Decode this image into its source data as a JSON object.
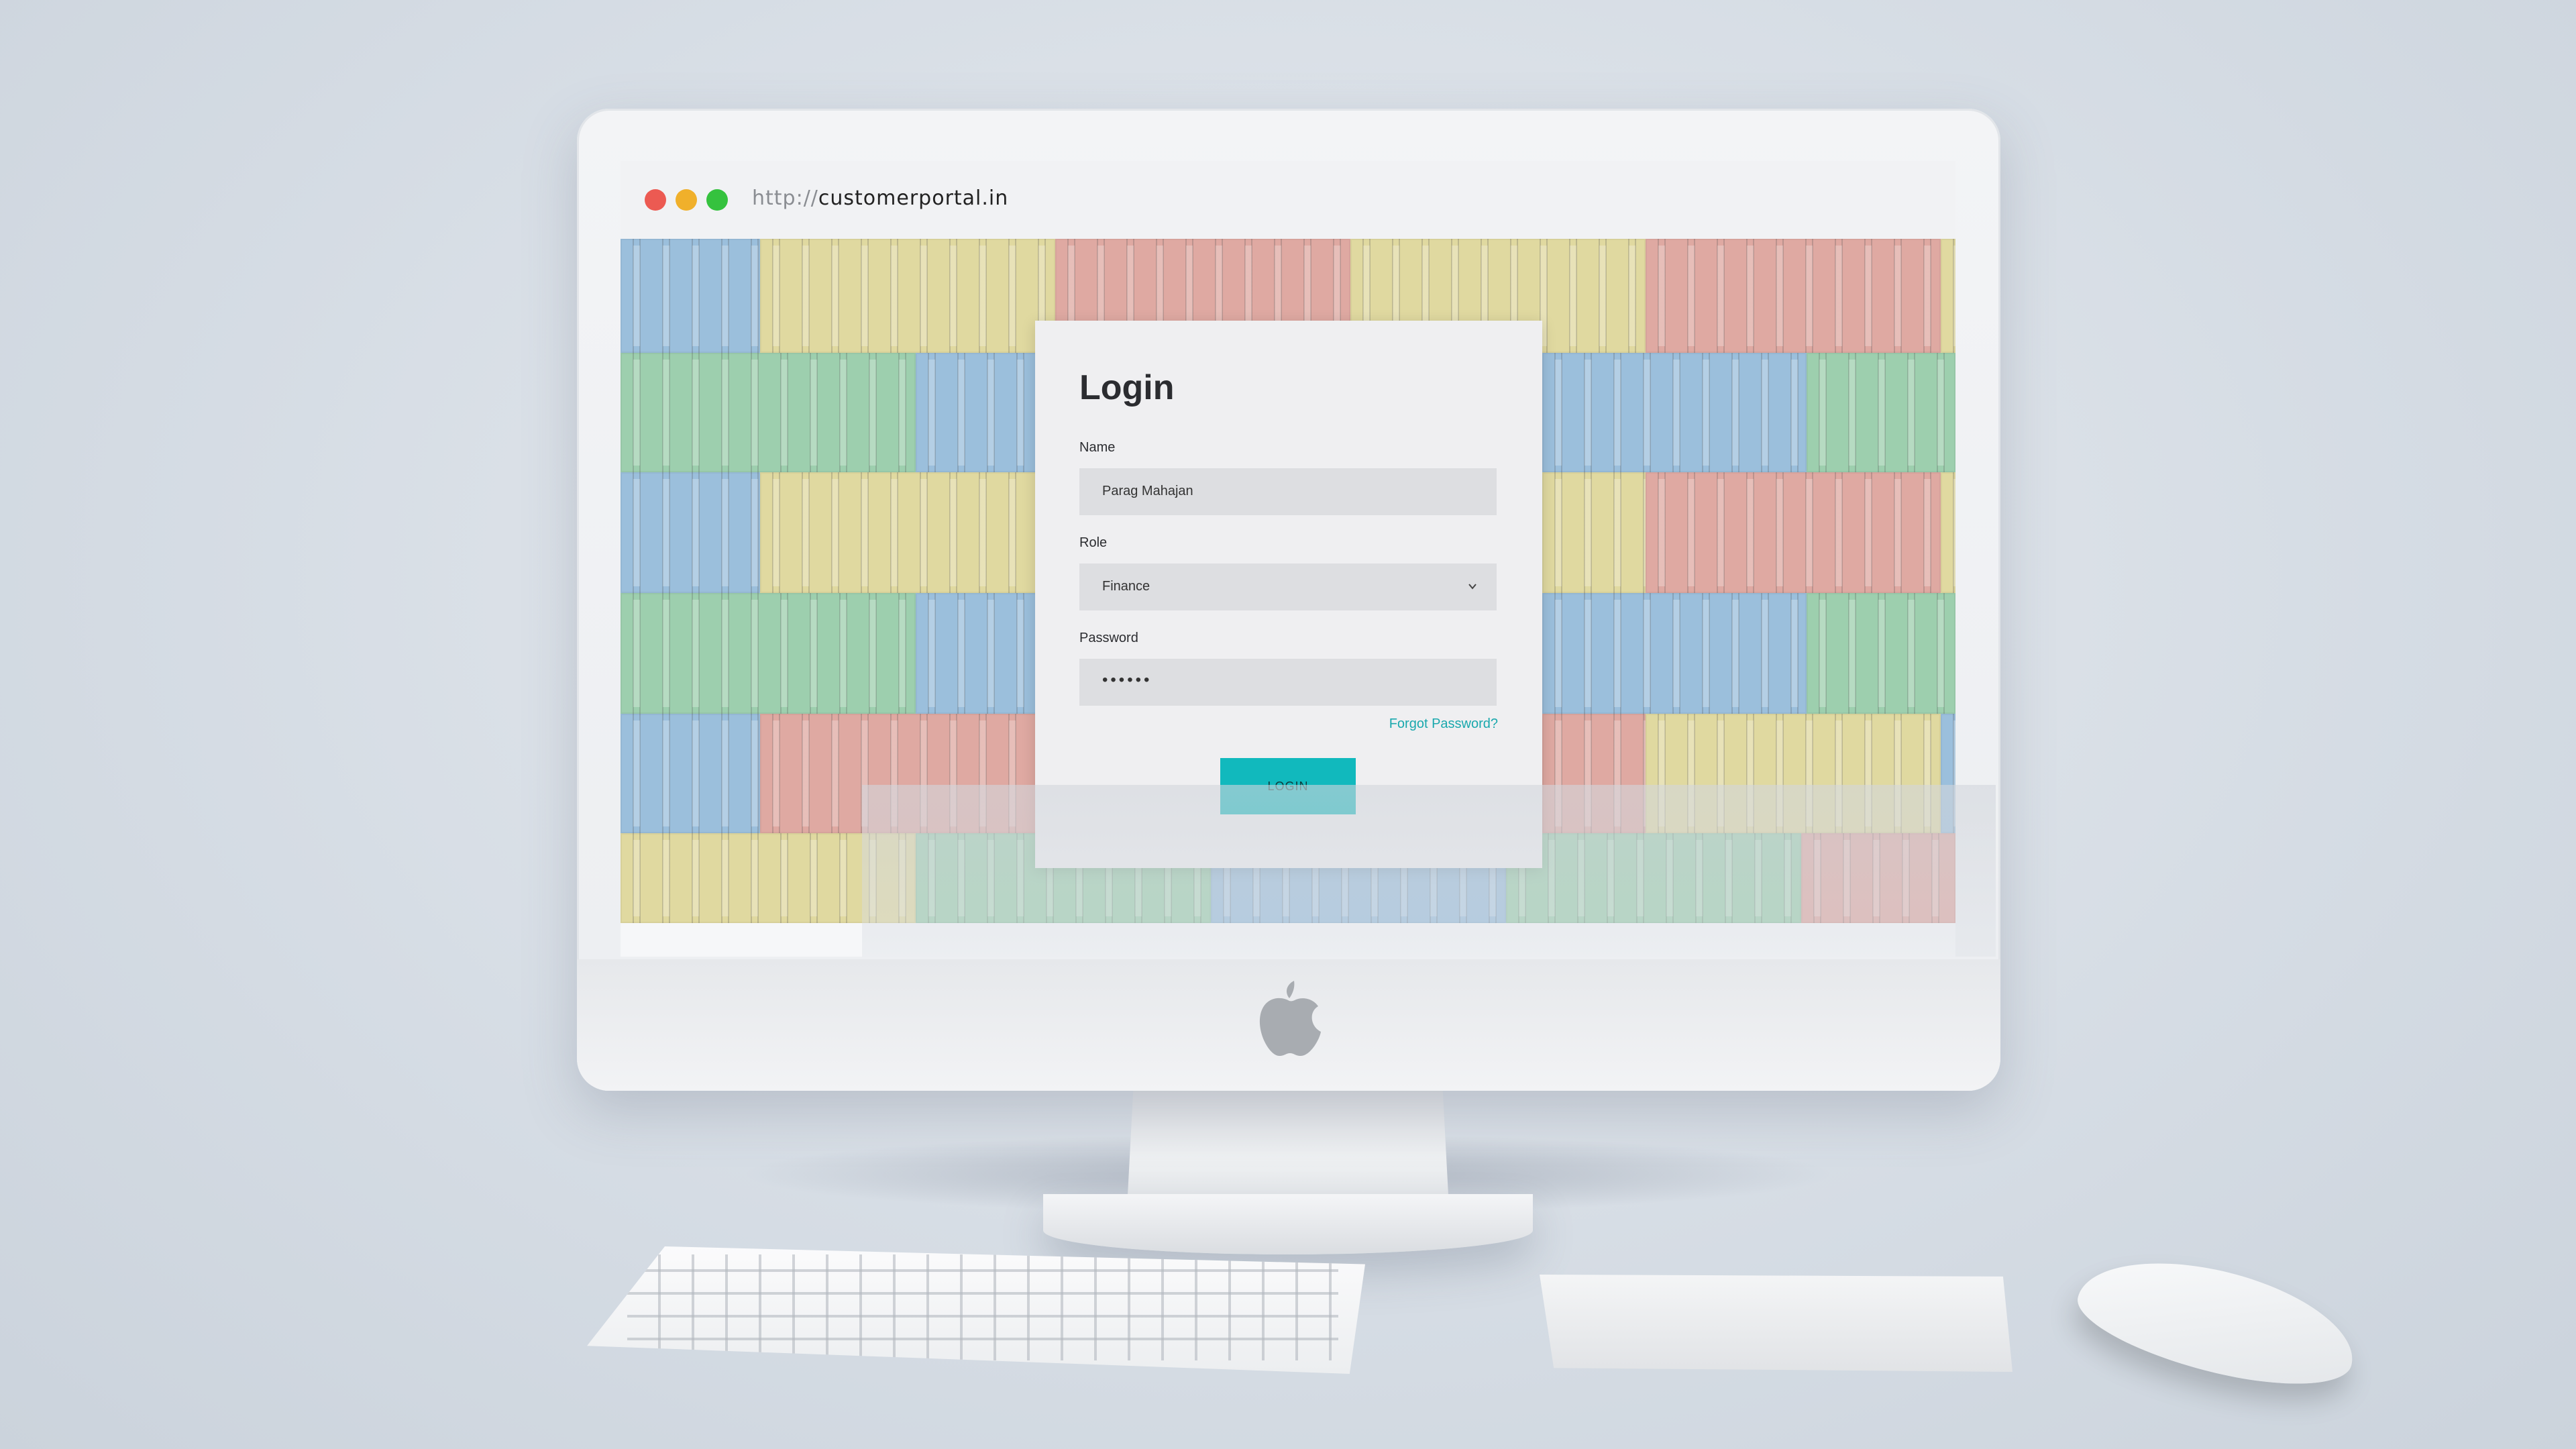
{
  "browser": {
    "url_protocol": "http://",
    "url_host": "customerportal.in",
    "window_controls": [
      "close",
      "minimize",
      "maximize"
    ]
  },
  "login": {
    "title": "Login",
    "name_label": "Name",
    "name_value": "Parag Mahajan",
    "role_label": "Role",
    "role_value": "Finance",
    "password_label": "Password",
    "password_value": "••••••",
    "forgot_password": "Forgot Password?",
    "login_button": "LOGIN"
  },
  "colors": {
    "accent": "#11b9bd",
    "crate_blue": "#9bbfdc",
    "crate_yellow": "#e0d9a0",
    "crate_red": "#dfa9a2",
    "crate_green": "#9dcfae"
  },
  "icons": [
    "apple-logo-icon",
    "chevron-down-icon"
  ]
}
